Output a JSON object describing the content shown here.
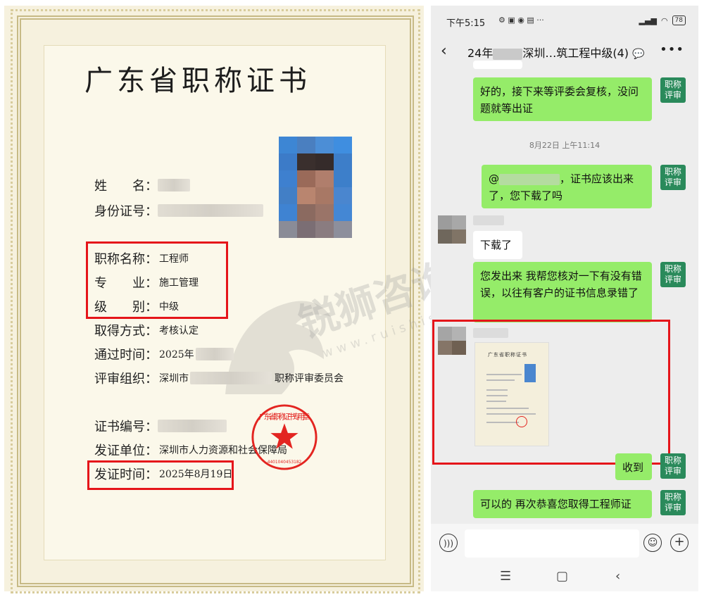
{
  "certificate": {
    "title": "广东省职称证书",
    "fields": {
      "name_label": "姓　　名：",
      "id_label": "身份证号：",
      "title_label": "职称名称：",
      "title_value": "工程师",
      "major_label": "专　　业：",
      "major_value": "施工管理",
      "level_label": "级　　别：",
      "level_value": "中级",
      "method_label": "取得方式：",
      "method_value": "考核认定",
      "pass_label": "通过时间：",
      "pass_value": "2025年",
      "org_label": "评审组织：",
      "org_value_prefix": "深圳市",
      "org_value_suffix": "职称评审委员会",
      "no_label": "证书编号：",
      "issuer_label": "发证单位：",
      "issuer_value": "深圳市人力资源和社会保障局",
      "date_label": "发证时间：",
      "date_value": "2025年8月19日"
    },
    "seal_text": "广东省职称证书专用章",
    "seal_number": "4401040453182",
    "watermark_text": "锐狮咨询",
    "watermark_url": "www.ruishis.vip"
  },
  "status_bar": {
    "time": "下午5:15",
    "battery": "78"
  },
  "chat": {
    "title_prefix": "24年",
    "title_suffix": "深圳…筑工程中级(4)",
    "tag_label_line1": "职称",
    "tag_label_line2": "评审",
    "messages": [
      {
        "side": "right",
        "text": "好的，接下来等评委会复核，没问题就等出证"
      },
      {
        "side": "time",
        "text": "8月22日 上午11:14"
      },
      {
        "side": "right",
        "text_prefix": "@",
        "text": "，证书应该出来了，您下载了吗"
      },
      {
        "side": "left",
        "text": "下载了"
      },
      {
        "side": "right",
        "text": "您发出来 我帮您核对一下有没有错误，以往有客户的证书信息录错了"
      },
      {
        "side": "left-image",
        "text": "广东省职称证书"
      },
      {
        "side": "right",
        "text": "收到"
      },
      {
        "side": "right",
        "text": "可以的  再次恭喜您取得工程师证"
      }
    ]
  },
  "icons": {
    "back": "chevron-left-icon",
    "more": "more-dots-icon",
    "voice": "voice-icon",
    "emoji": "emoji-icon",
    "plus": "plus-icon"
  },
  "colors": {
    "highlight": "#e5151a",
    "chat_green": "#95ec69",
    "tag_green": "#2a8a5b"
  }
}
